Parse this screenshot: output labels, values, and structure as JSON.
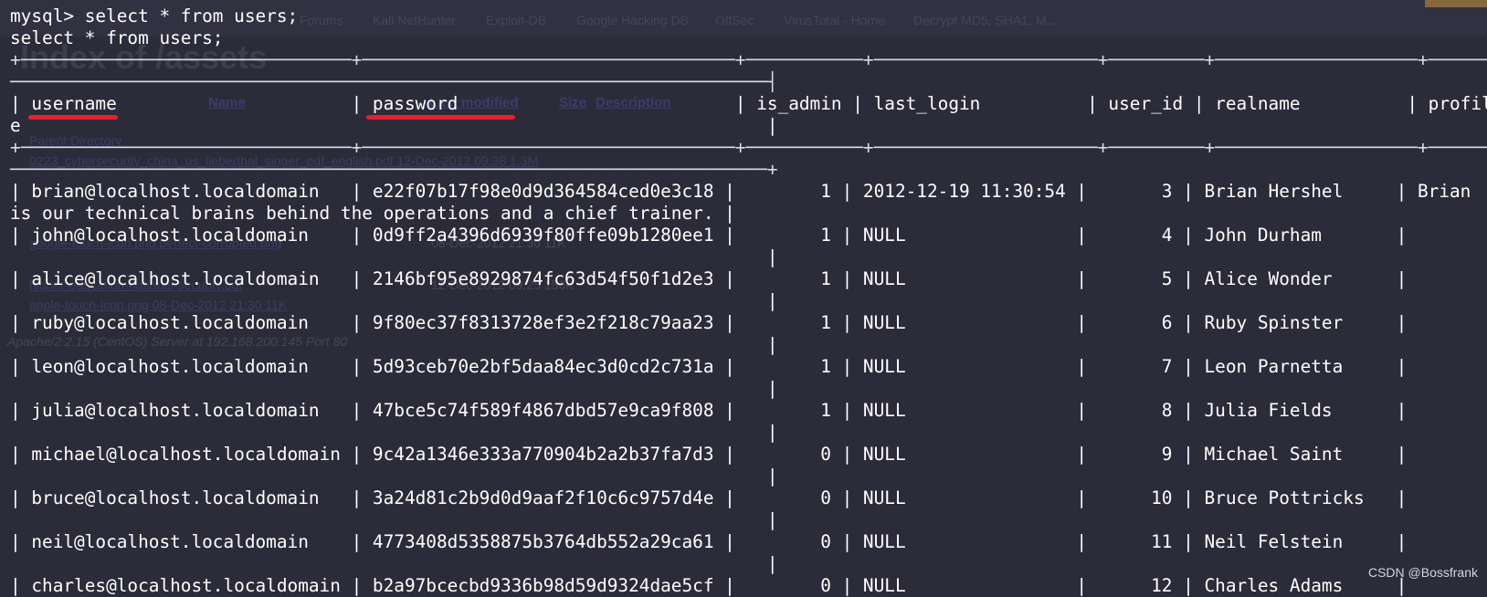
{
  "ghost_browser": {
    "bookmarks": [
      "Forums",
      "Kali NetHunter",
      "Exploit-DB",
      "Google Hacking DB",
      "OffSec",
      "VirusTotal - Home",
      "Decrypt MD5, SHA1, M..."
    ],
    "page_title": "Index of /assets",
    "headers": [
      "Name",
      "Last modified",
      "Size",
      "Description"
    ],
    "rows": [
      "Parent Directory",
      "0223_cybersecurity_china_us_lieberthal_singer_pdf_english.pdf 12-Dec-2012 09:38 1.3M",
      "google-touch-icon.png perfect-corrupted.png",
      "08-Dec-2012 21:30 11K",
      "higher-education-national-security.pdf",
      "12-Dec-2012 09:25 156K",
      "apple-touch-icon.png 08-Dec-2012 21:30 11K"
    ],
    "server_line": "Apache/2.2.15 (CentOS) Server at 192.168.200.145 Port 80"
  },
  "terminal": {
    "lines": [
      "mysql> select * from users;",
      "select * from users;",
      "+───────────────────────────────+───────────────────────────────────+───────────+─────────────────────+─────────+───────────────────+──────────",
      "───────────────────────────────────────────────────────────────────────┤",
      "| username                      | password                          | is_admin | last_login          | user_id | realname          | profil",
      "e                                                                      |",
      "+───────────────────────────────+───────────────────────────────────+───────────+─────────────────────+─────────+───────────────────+──────────",
      "───────────────────────────────────────────────────────────────────────+",
      "| brian@localhost.localdomain   | e22f07b17f98e0d9d364584ced0e3c18 |        1 | 2012-12-19 11:30:54 |       3 | Brian Hershel     | Brian",
      "is our technical brains behind the operations and a chief trainer. |",
      "| john@localhost.localdomain    | 0d9ff2a4396d6939f80ffe09b1280ee1 |        1 | NULL                |       4 | John Durham       |",
      "                                                                       |",
      "| alice@localhost.localdomain   | 2146bf95e8929874fc63d54f50f1d2e3 |        1 | NULL                |       5 | Alice Wonder      |",
      "                                                                       |",
      "| ruby@localhost.localdomain    | 9f80ec37f8313728ef3e2f218c79aa23 |        1 | NULL                |       6 | Ruby Spinster     |",
      "                                                                       |",
      "| leon@localhost.localdomain    | 5d93ceb70e2bf5daa84ec3d0cd2c731a |        1 | NULL                |       7 | Leon Parnetta     |",
      "                                                                       |",
      "| julia@localhost.localdomain   | 47bce5c74f589f4867dbd57e9ca9f808 |        1 | NULL                |       8 | Julia Fields      |",
      "                                                                       |",
      "| michael@localhost.localdomain | 9c42a1346e333a770904b2a2b37fa7d3 |        0 | NULL                |       9 | Michael Saint     |",
      "                                                                       |",
      "| bruce@localhost.localdomain   | 3a24d81c2b9d0d9aaf2f10c6c9757d4e |        0 | NULL                |      10 | Bruce Pottricks   |",
      "                                                                       |",
      "| neil@localhost.localdomain    | 4773408d5358875b3764db552a29ca61 |        0 | NULL                |      11 | Neil Felstein     |",
      "                                                                       |",
      "| charles@localhost.localdomain | b2a97bcecbd9336b98d59d9324dae5cf |        0 | NULL                |      12 | Charles Adams     |"
    ]
  },
  "watermark": "CSDN @Bossfrank",
  "colors": {
    "background": "#2b2b3a",
    "text": "#ffffff",
    "annotation": "#e8202a"
  }
}
